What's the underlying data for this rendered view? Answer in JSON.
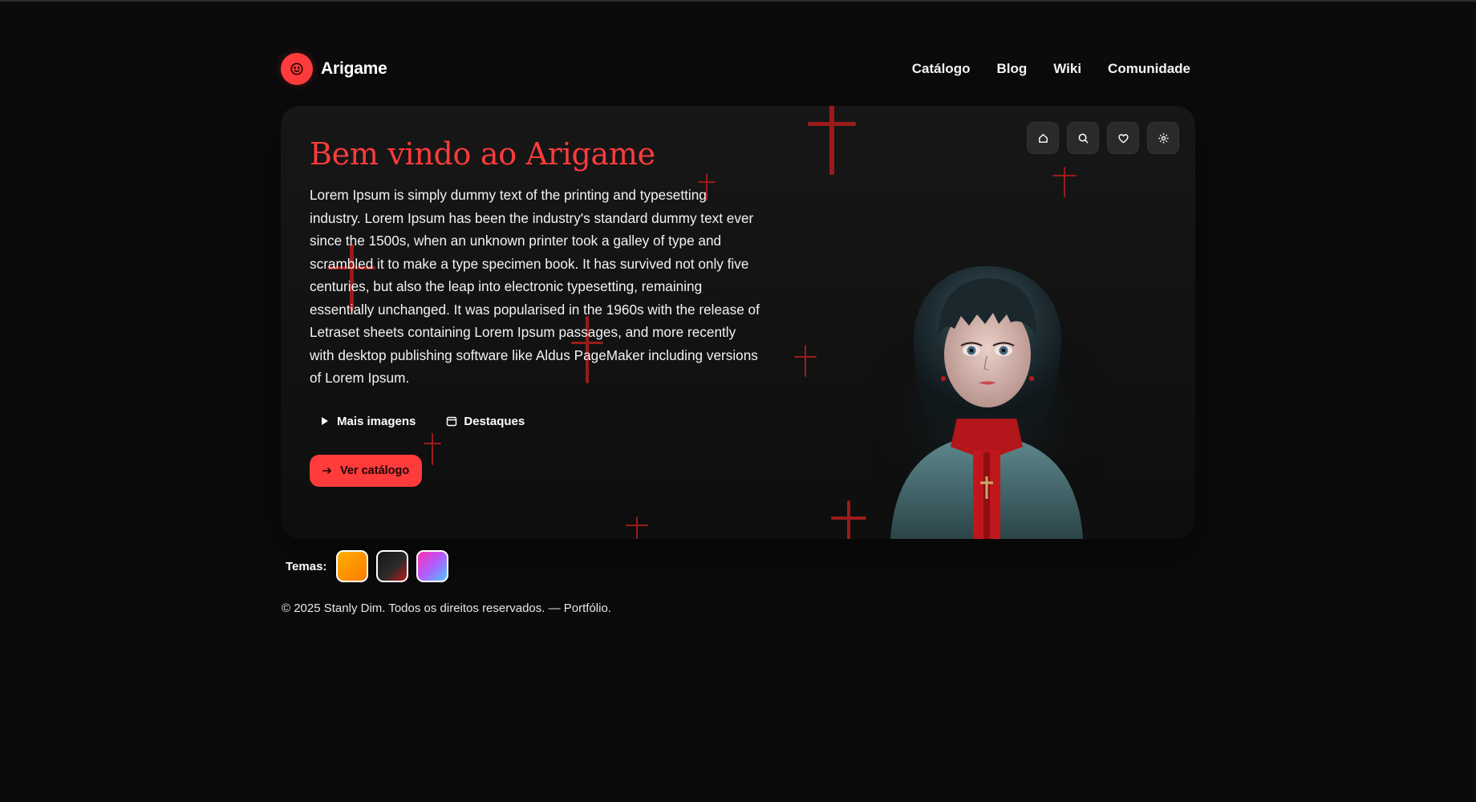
{
  "brand": {
    "name": "Arigame",
    "logo_icon": "smiley-icon"
  },
  "nav": {
    "items": [
      {
        "label": "Catálogo"
      },
      {
        "label": "Blog"
      },
      {
        "label": "Wiki"
      },
      {
        "label": "Comunidade"
      }
    ]
  },
  "hero": {
    "title": "Bem vindo ao Arigame",
    "text": "Lorem Ipsum is simply dummy text of the printing and typesetting industry. Lorem Ipsum has been the industry's standard dummy text ever since the 1500s, when an unknown printer took a galley of type and scrambled it to make a type specimen book. It has survived not only five centuries, but also the leap into electronic typesetting, remaining essentially unchanged. It was popularised in the 1960s with the release of Letraset sheets containing Lorem Ipsum passages, and more recently with desktop publishing software like Aldus PageMaker including versions of Lorem Ipsum.",
    "chips": [
      {
        "label": "Mais imagens",
        "icon": "play-icon"
      },
      {
        "label": "Destaques",
        "icon": "calendar-icon"
      }
    ],
    "cta": {
      "label": "Ver catálogo",
      "icon": "arrow-right-icon"
    },
    "toolbar": [
      "home-icon",
      "search-icon",
      "heart-icon",
      "settings-icon"
    ]
  },
  "themes": {
    "label": "Temas:",
    "options": [
      "orange",
      "dark-red",
      "pink-blue-gradient"
    ]
  },
  "footer": {
    "text": "© 2025 Stanly Dim. Todos os direitos reservados. — Portfólio."
  },
  "colors": {
    "accent": "#ff3b3b",
    "background": "#0b0b0c",
    "card": "#151515",
    "cross": "#9b1b1b"
  }
}
